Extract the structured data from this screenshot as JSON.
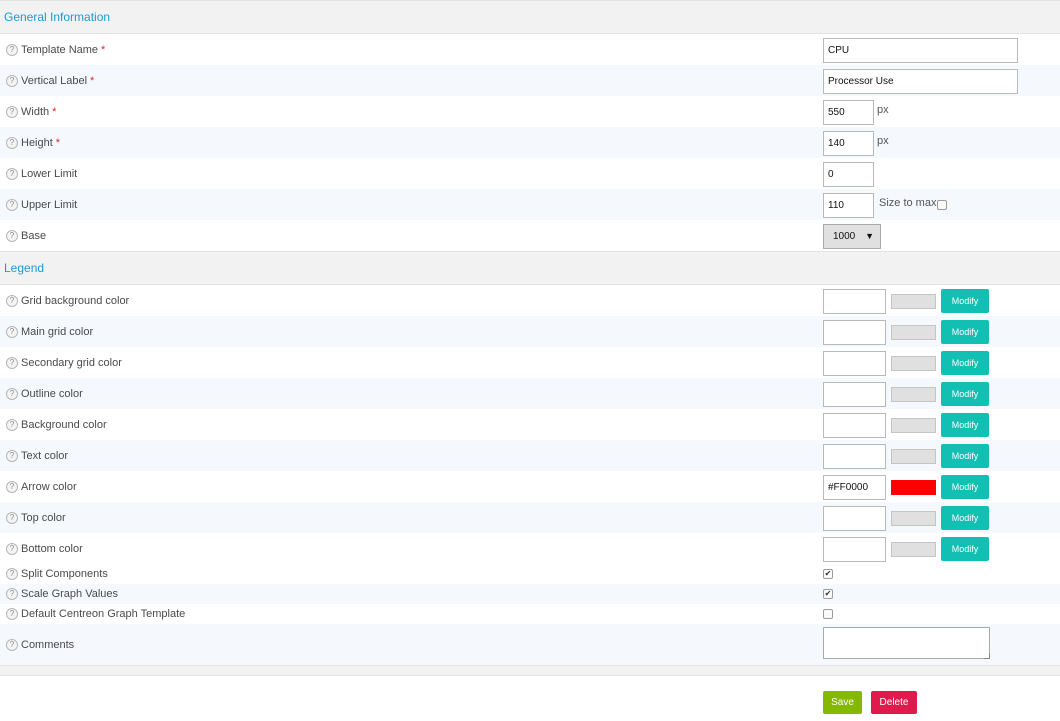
{
  "sections": {
    "general": "General Information",
    "legend": "Legend"
  },
  "help_glyph": "?",
  "required_mark": "*",
  "general": {
    "template_name": {
      "label": "Template Name",
      "value": "CPU"
    },
    "vertical_label": {
      "label": "Vertical Label",
      "value": "Processor Use"
    },
    "width": {
      "label": "Width",
      "value": "550",
      "unit": "px"
    },
    "height": {
      "label": "Height",
      "value": "140",
      "unit": "px"
    },
    "lower_limit": {
      "label": "Lower Limit",
      "value": "0"
    },
    "upper_limit": {
      "label": "Upper Limit",
      "value": "110",
      "size_to_max_label": "Size to max",
      "size_to_max_checked": false
    },
    "base": {
      "label": "Base",
      "value": "1000",
      "caret": "▼"
    }
  },
  "legend": {
    "modify_label": "Modify",
    "colors": [
      {
        "label": "Grid background color",
        "value": "",
        "swatch": "#e0e0e0"
      },
      {
        "label": "Main grid color",
        "value": "",
        "swatch": "#e0e0e0"
      },
      {
        "label": "Secondary grid color",
        "value": "",
        "swatch": "#e0e0e0"
      },
      {
        "label": "Outline color",
        "value": "",
        "swatch": "#e0e0e0"
      },
      {
        "label": "Background color",
        "value": "",
        "swatch": "#e0e0e0"
      },
      {
        "label": "Text color",
        "value": "",
        "swatch": "#e0e0e0"
      },
      {
        "label": "Arrow color",
        "value": "#FF0000",
        "swatch": "#ff0000"
      },
      {
        "label": "Top color",
        "value": "",
        "swatch": "#e0e0e0"
      },
      {
        "label": "Bottom color",
        "value": "",
        "swatch": "#e0e0e0"
      }
    ],
    "split_components": {
      "label": "Split Components",
      "checked": true
    },
    "scale_graph_values": {
      "label": "Scale Graph Values",
      "checked": true
    },
    "default_template": {
      "label": "Default Centreon Graph Template",
      "checked": false
    },
    "comments": {
      "label": "Comments",
      "value": ""
    }
  },
  "checkmark_glyph": "✔",
  "actions": {
    "save": "Save",
    "delete": "Delete"
  },
  "colors": {
    "accent": "#1c9ad6",
    "modify_button": "#12bfb3",
    "save_button": "#84b900",
    "delete_button": "#df1b4d",
    "required": "#e0252b"
  }
}
